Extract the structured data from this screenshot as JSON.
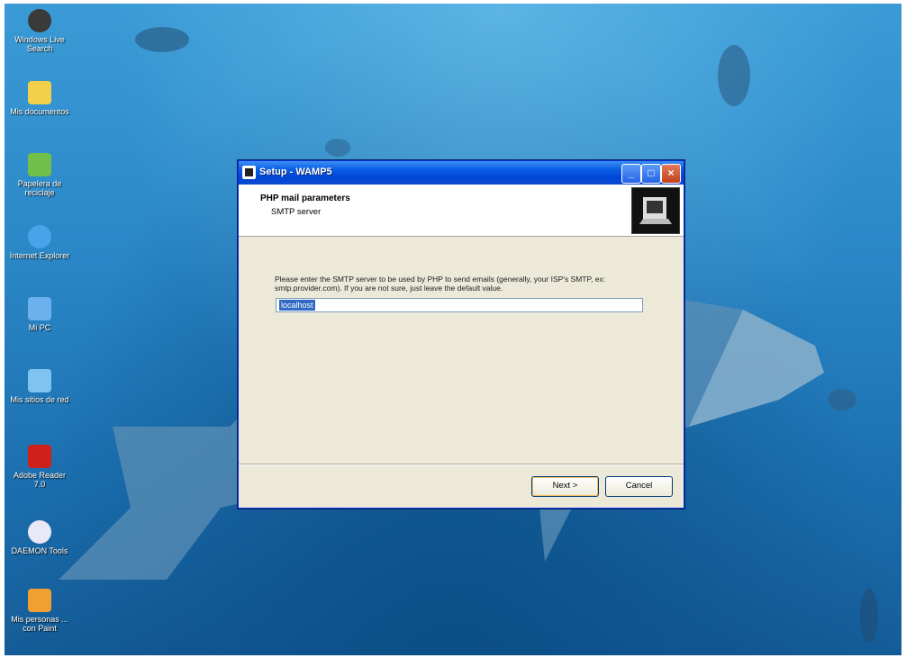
{
  "desktop": {
    "icons": [
      {
        "label": "Windows Live Search",
        "color": "#3a3a3a"
      },
      {
        "label": "Mis documentos",
        "color": "#f2d04a"
      },
      {
        "label": "Papelera de reciclaje",
        "color": "#6fbf4a"
      },
      {
        "label": "Internet Explorer",
        "color": "#4aa3e8"
      },
      {
        "label": "Mi PC",
        "color": "#6cb0ee"
      },
      {
        "label": "Mis sitios de red",
        "color": "#7fc3f0"
      },
      {
        "label": "Adobe Reader 7.0",
        "color": "#d0201c"
      },
      {
        "label": "DAEMON Tools",
        "color": "#e8e8f6"
      },
      {
        "label": "Mis personas ... con Paint",
        "color": "#f0a030"
      }
    ]
  },
  "window": {
    "title": "Setup - WAMP5",
    "header": {
      "title": "PHP mail parameters",
      "subtitle": "SMTP server"
    },
    "instructions": "Please enter the SMTP server to be used by PHP to send emails (generally, your ISP's SMTP, ex: smtp.provider.com). If you are not sure, just leave the default value.",
    "smtp_value": "localhost",
    "buttons": {
      "next": "Next >",
      "cancel": "Cancel"
    }
  },
  "colors": {
    "titlebar": "#0a5ee5",
    "dialog_bg": "#ece9d8",
    "selection": "#316ac5"
  }
}
